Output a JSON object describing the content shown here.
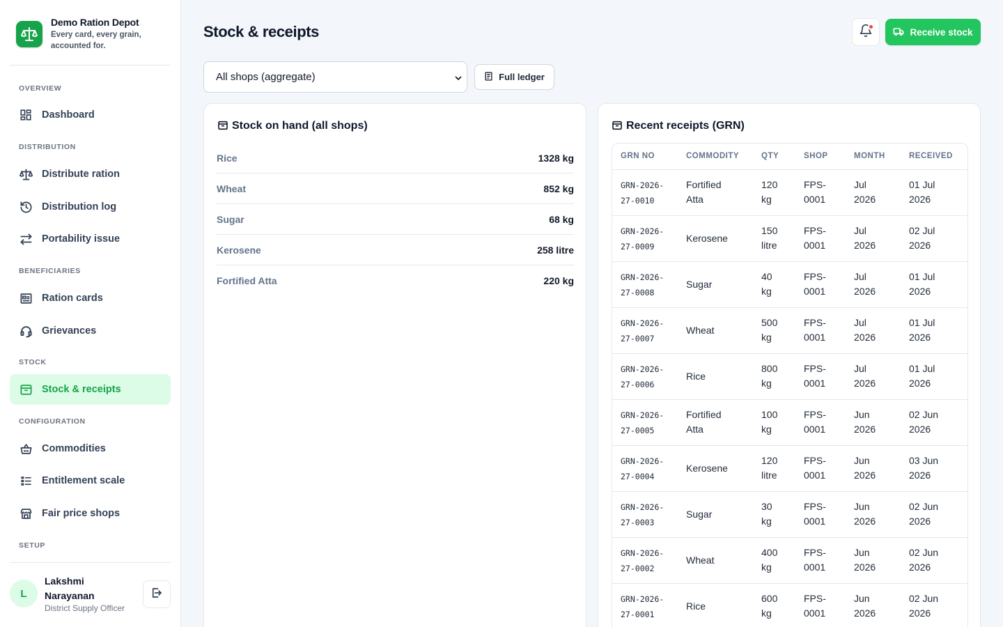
{
  "brand": {
    "name": "Demo Ration Depot",
    "tagline_line1": "Every card, every grain,",
    "tagline_line2": "accounted for.",
    "accent_color": "#16a34a"
  },
  "sidebar": {
    "sections": {
      "overview": "OVERVIEW",
      "distribution": "DISTRIBUTION",
      "beneficiaries": "BENEFICIARIES",
      "stock": "STOCK",
      "configuration": "CONFIGURATION",
      "setup": "SETUP"
    },
    "items": {
      "dashboard": "Dashboard",
      "distribute_ration": "Distribute ration",
      "distribution_log": "Distribution log",
      "portability_issue": "Portability issue",
      "ration_cards": "Ration cards",
      "grievances": "Grievances",
      "stock_receipts": "Stock & receipts",
      "commodities": "Commodities",
      "entitlement_scale": "Entitlement scale",
      "fair_price_shops": "Fair price shops"
    },
    "active_item": "Stock & receipts"
  },
  "user": {
    "initial": "L",
    "name": "Lakshmi Narayanan",
    "role": "District Supply Officer"
  },
  "header": {
    "title": "Stock & receipts",
    "receive_label": "Receive stock"
  },
  "filters": {
    "shop_selected": "All shops (aggregate)",
    "ledger_label": "Full ledger"
  },
  "stock": {
    "title": "Stock on hand (all shops)",
    "rows": [
      {
        "name": "Rice",
        "qty": "1328 kg"
      },
      {
        "name": "Wheat",
        "qty": "852 kg"
      },
      {
        "name": "Sugar",
        "qty": "68 kg"
      },
      {
        "name": "Kerosene",
        "qty": "258 litre"
      },
      {
        "name": "Fortified Atta",
        "qty": "220 kg"
      }
    ]
  },
  "receipts": {
    "title": "Recent receipts (GRN)",
    "columns": {
      "grn": "GRN NO",
      "commodity": "COMMODITY",
      "qty": "QTY",
      "shop": "SHOP",
      "month": "MONTH",
      "received": "RECEIVED"
    },
    "rows": [
      {
        "grn_a": "GRN-2026-",
        "grn_b": "27-0010",
        "commodity_a": "Fortified",
        "commodity_b": "Atta",
        "qty_a": "120",
        "qty_b": "kg",
        "shop_a": "FPS-",
        "shop_b": "0001",
        "month_a": "Jul",
        "month_b": "2026",
        "received_a": "01 Jul",
        "received_b": "2026"
      },
      {
        "grn_a": "GRN-2026-",
        "grn_b": "27-0009",
        "commodity_a": "Kerosene",
        "commodity_b": "",
        "qty_a": "150",
        "qty_b": "litre",
        "shop_a": "FPS-",
        "shop_b": "0001",
        "month_a": "Jul",
        "month_b": "2026",
        "received_a": "02 Jul",
        "received_b": "2026"
      },
      {
        "grn_a": "GRN-2026-",
        "grn_b": "27-0008",
        "commodity_a": "Sugar",
        "commodity_b": "",
        "qty_a": "40",
        "qty_b": "kg",
        "shop_a": "FPS-",
        "shop_b": "0001",
        "month_a": "Jul",
        "month_b": "2026",
        "received_a": "01 Jul",
        "received_b": "2026"
      },
      {
        "grn_a": "GRN-2026-",
        "grn_b": "27-0007",
        "commodity_a": "Wheat",
        "commodity_b": "",
        "qty_a": "500",
        "qty_b": "kg",
        "shop_a": "FPS-",
        "shop_b": "0001",
        "month_a": "Jul",
        "month_b": "2026",
        "received_a": "01 Jul",
        "received_b": "2026"
      },
      {
        "grn_a": "GRN-2026-",
        "grn_b": "27-0006",
        "commodity_a": "Rice",
        "commodity_b": "",
        "qty_a": "800",
        "qty_b": "kg",
        "shop_a": "FPS-",
        "shop_b": "0001",
        "month_a": "Jul",
        "month_b": "2026",
        "received_a": "01 Jul",
        "received_b": "2026"
      },
      {
        "grn_a": "GRN-2026-",
        "grn_b": "27-0005",
        "commodity_a": "Fortified",
        "commodity_b": "Atta",
        "qty_a": "100",
        "qty_b": "kg",
        "shop_a": "FPS-",
        "shop_b": "0001",
        "month_a": "Jun",
        "month_b": "2026",
        "received_a": "02 Jun",
        "received_b": "2026"
      },
      {
        "grn_a": "GRN-2026-",
        "grn_b": "27-0004",
        "commodity_a": "Kerosene",
        "commodity_b": "",
        "qty_a": "120",
        "qty_b": "litre",
        "shop_a": "FPS-",
        "shop_b": "0001",
        "month_a": "Jun",
        "month_b": "2026",
        "received_a": "03 Jun",
        "received_b": "2026"
      },
      {
        "grn_a": "GRN-2026-",
        "grn_b": "27-0003",
        "commodity_a": "Sugar",
        "commodity_b": "",
        "qty_a": "30",
        "qty_b": "kg",
        "shop_a": "FPS-",
        "shop_b": "0001",
        "month_a": "Jun",
        "month_b": "2026",
        "received_a": "02 Jun",
        "received_b": "2026"
      },
      {
        "grn_a": "GRN-2026-",
        "grn_b": "27-0002",
        "commodity_a": "Wheat",
        "commodity_b": "",
        "qty_a": "400",
        "qty_b": "kg",
        "shop_a": "FPS-",
        "shop_b": "0001",
        "month_a": "Jun",
        "month_b": "2026",
        "received_a": "02 Jun",
        "received_b": "2026"
      },
      {
        "grn_a": "GRN-2026-",
        "grn_b": "27-0001",
        "commodity_a": "Rice",
        "commodity_b": "",
        "qty_a": "600",
        "qty_b": "kg",
        "shop_a": "FPS-",
        "shop_b": "0001",
        "month_a": "Jun",
        "month_b": "2026",
        "received_a": "02 Jun",
        "received_b": "2026"
      }
    ]
  },
  "icons": {
    "brand": "scale-icon",
    "notifications": "bell-icon",
    "receive": "truck-icon",
    "ledger": "ledger-icon",
    "logout": "logout-icon"
  }
}
